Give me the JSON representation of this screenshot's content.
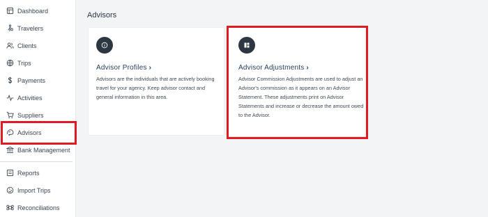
{
  "sidebar": {
    "items": [
      {
        "label": "Dashboard",
        "icon": "dashboard-icon"
      },
      {
        "label": "Travelers",
        "icon": "travelers-icon"
      },
      {
        "label": "Clients",
        "icon": "clients-icon"
      },
      {
        "label": "Trips",
        "icon": "trips-icon"
      },
      {
        "label": "Payments",
        "icon": "dollar-icon"
      },
      {
        "label": "Activities",
        "icon": "activity-icon"
      },
      {
        "label": "Suppliers",
        "icon": "cart-icon"
      },
      {
        "label": "Advisors",
        "icon": "advisor-icon"
      },
      {
        "label": "Bank Management",
        "icon": "bank-icon"
      },
      {
        "label": "Reports",
        "icon": "reports-icon"
      },
      {
        "label": "Import Trips",
        "icon": "import-icon"
      },
      {
        "label": "Reconciliations",
        "icon": "command-icon"
      }
    ]
  },
  "main": {
    "title": "Advisors",
    "cards": [
      {
        "title": "Advisor Profiles",
        "chevron": "›",
        "description": "Advisors are the individuals that are actively booking travel for your agency. Keep advisor contact and general information in this area.",
        "icon": "info-icon"
      },
      {
        "title": "Advisor Adjustments",
        "chevron": "›",
        "description": "Advisor Commission Adjustments are used to adjust an Advisor's commission as it appears on an Advisor Statement. These adjustments print on Advisor Statements and increase or decrease the amount owed to the Advisor.",
        "icon": "widgets-icon"
      }
    ]
  },
  "colors": {
    "highlight": "#e01a22",
    "icon_circle": "#2c3742",
    "title_text": "#26415c",
    "background": "#f3f4f6"
  }
}
